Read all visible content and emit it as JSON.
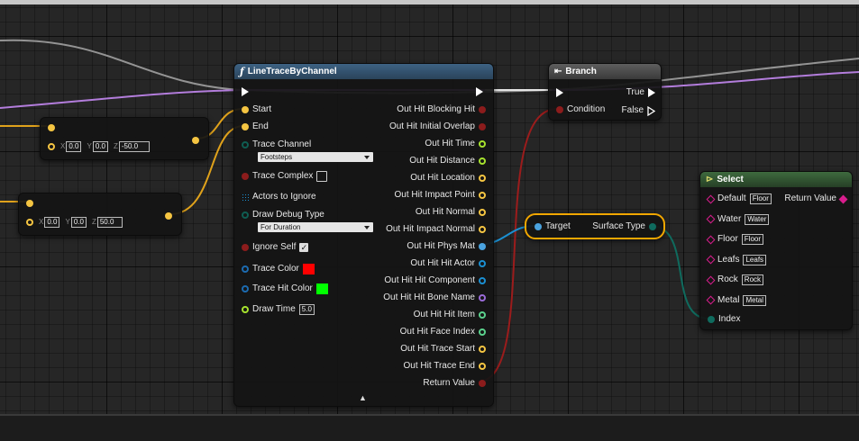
{
  "colors": {
    "exec": "#ffffff",
    "float": "#a6e22e",
    "vector": "#f5c542",
    "bool": "#8c1c1c",
    "name": "#e07ecf",
    "struct": "#4aa3df",
    "object": "#1b8fd1",
    "enum": "#0f5d52",
    "linear_color": "#1c6bb0",
    "byte": "#0f6b5e",
    "wildcard": "#d91d8d",
    "hit_green": "#5bd18c",
    "hit_purple": "#9a6bd8",
    "wire_exec": "#cfcfcf",
    "wire_vector": "#e0a21b",
    "wire_bool": "#9b1c1c",
    "wire_struct": "#1b8fd1",
    "wire_enum": "#0f6b5e",
    "wire_purple": "#b37ddc"
  },
  "vec_node_1": {
    "x": "0.0",
    "y": "0.0",
    "z": "-50.0"
  },
  "vec_node_2": {
    "x": "0.0",
    "y": "0.0",
    "z": "50.0"
  },
  "axes": {
    "x": "X",
    "y": "Y",
    "z": "Z"
  },
  "line_trace": {
    "title": "LineTraceByChannel",
    "title_icon": "function-icon",
    "inputs": {
      "start": "Start",
      "end": "End",
      "trace_channel": "Trace Channel",
      "trace_channel_value": "Footsteps",
      "trace_complex": "Trace Complex",
      "actors_to_ignore": "Actors to Ignore",
      "draw_debug_type": "Draw Debug Type",
      "draw_debug_value": "For Duration",
      "ignore_self": "Ignore Self",
      "trace_color": "Trace Color",
      "trace_hit_color": "Trace Hit Color",
      "draw_time": "Draw Time",
      "draw_time_value": "5.0"
    },
    "outputs": [
      "Out Hit Blocking Hit",
      "Out Hit Initial Overlap",
      "Out Hit Time",
      "Out Hit Distance",
      "Out Hit Location",
      "Out Hit Impact Point",
      "Out Hit Normal",
      "Out Hit Impact Normal",
      "Out Hit Phys Mat",
      "Out Hit Hit Actor",
      "Out Hit Hit Component",
      "Out Hit Hit Bone Name",
      "Out Hit Hit Item",
      "Out Hit Face Index",
      "Out Hit Trace Start",
      "Out Hit Trace End",
      "Return Value"
    ],
    "trace_color": "#ff0000",
    "trace_hit_color": "#00ff00",
    "expand_glyph": "▲"
  },
  "branch": {
    "title": "Branch",
    "title_icon": "branch-icon",
    "condition": "Condition",
    "true_label": "True",
    "false_label": "False"
  },
  "surface": {
    "target": "Target",
    "surface_type": "Surface Type"
  },
  "select": {
    "title": "Select",
    "title_icon": "select-icon",
    "options": [
      {
        "label": "Default",
        "value": "Floor"
      },
      {
        "label": "Water",
        "value": "Water"
      },
      {
        "label": "Floor",
        "value": "Floor"
      },
      {
        "label": "Leafs",
        "value": "Leafs"
      },
      {
        "label": "Rock",
        "value": "Rock"
      },
      {
        "label": "Metal",
        "value": "Metal"
      }
    ],
    "index": "Index",
    "return_value": "Return Value"
  }
}
